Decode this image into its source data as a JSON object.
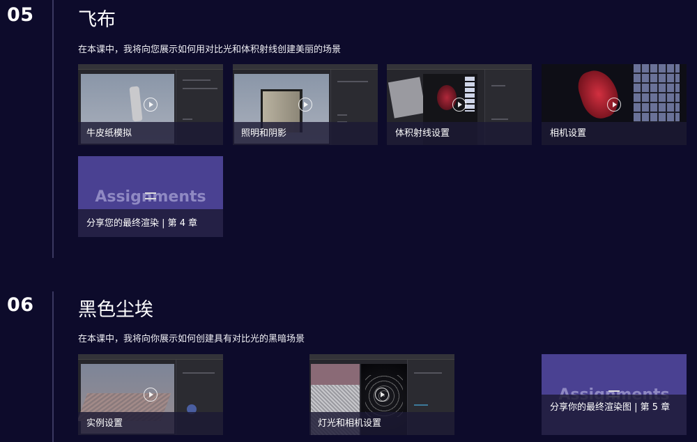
{
  "sections": [
    {
      "number": "05",
      "title": "飞布",
      "description": "在本课中，我将向您展示如何用对比光和体积射线创建美丽的场景",
      "lessons": [
        {
          "label": "牛皮纸模拟",
          "thumb": "cloth-viewport"
        },
        {
          "label": "照明和阴影",
          "thumb": "light-box-viewport"
        },
        {
          "label": "体积射线设置",
          "thumb": "volumetric-red-viewport"
        },
        {
          "label": "相机设置",
          "thumb": "red-cloth-render"
        },
        {
          "label": "分享您的最终渲染 | 第 4 章",
          "thumb": "assignments",
          "overlay_word": "Assignments"
        }
      ]
    },
    {
      "number": "06",
      "title": "黑色尘埃",
      "description": "在本课中，我将向你展示如何创建具有对比光的黑暗场景",
      "lessons": [
        {
          "label": "实例设置",
          "thumb": "instance-viewport"
        },
        {
          "label": "灯光和相机设置",
          "thumb": "dust-viewport"
        },
        {
          "label": "分享你的最终渲染图 | 第 5 章",
          "thumb": "assignments",
          "overlay_word": "Assignments"
        }
      ]
    }
  ],
  "colors": {
    "background": "#0d0b2b",
    "divider": "#3a3860",
    "assignment_card": "#4a4192",
    "overlay": "#1c1a34"
  }
}
